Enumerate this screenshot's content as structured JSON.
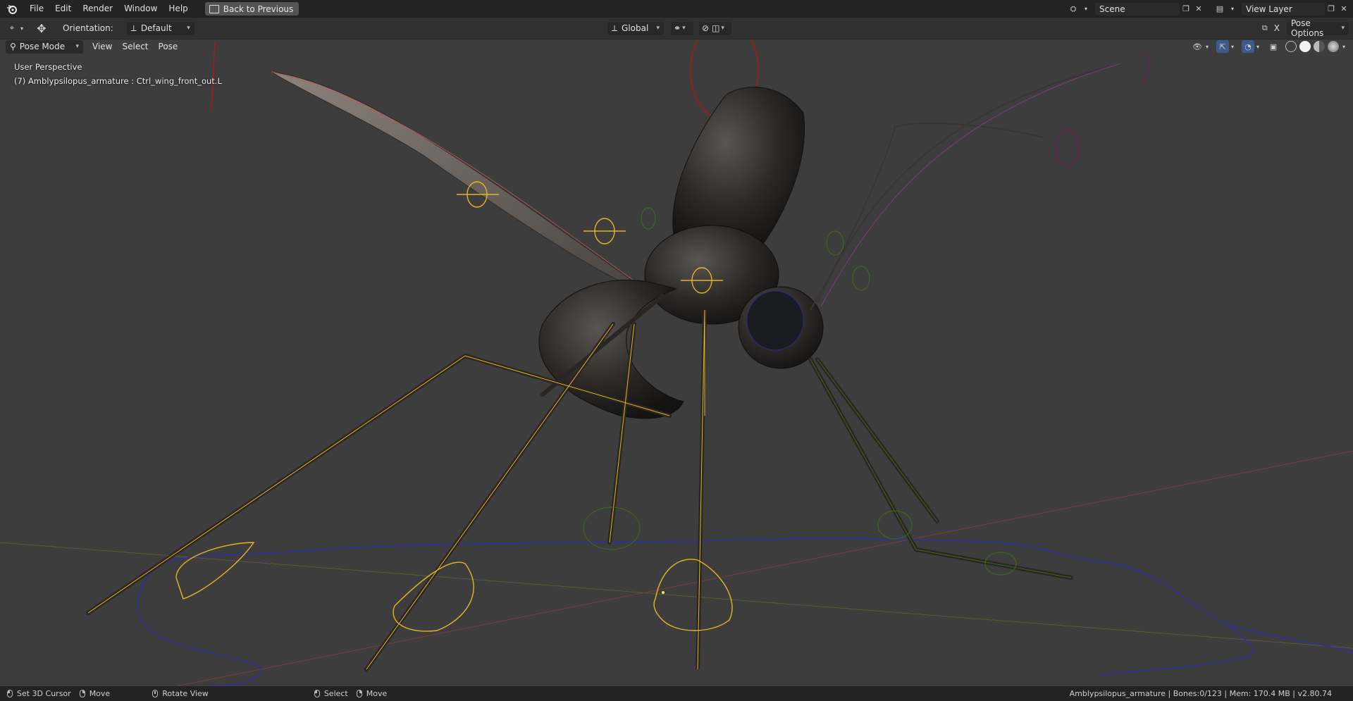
{
  "menu": {
    "items": [
      "File",
      "Edit",
      "Render",
      "Window",
      "Help"
    ],
    "back_button": "Back to Previous"
  },
  "top_right": {
    "scene_value": "Scene",
    "view_layer_value": "View Layer"
  },
  "header": {
    "orientation_label": "Orientation:",
    "orientation_value": "Default",
    "transform_value": "Global",
    "pose_options": "Pose Options",
    "x_label": "X"
  },
  "viewport_header": {
    "mode": "Pose Mode",
    "menus": [
      "View",
      "Select",
      "Pose"
    ]
  },
  "viewport": {
    "perspective": "User Perspective",
    "active_info": "(7) Amblypsilopus_armature : Ctrl_wing_front_out.L"
  },
  "statusbar": {
    "set_cursor": "Set 3D Cursor",
    "move1": "Move",
    "rotate_view": "Rotate View",
    "select": "Select",
    "move2": "Move",
    "info": "Amblypsilopus_armature | Bones:0/123 | Mem: 170.4 MB | v2.80.74"
  },
  "colors": {
    "topbar": "#232323",
    "header": "#303030",
    "viewport": "#3d3d3d",
    "bone_selected": "#e6b520",
    "bone_control": "#2a2aa8",
    "bone_red": "#b01515",
    "bone_green": "#3f6b1a"
  },
  "icons": [
    "blender-logo-icon",
    "editor-type-icon",
    "transform-gizmo-icon",
    "orientation-icon",
    "transform-icon",
    "snap-icon",
    "proportional-icon",
    "scene-icon",
    "view-layer-icon",
    "overlay-icon",
    "gizmo-icon",
    "xray-icon",
    "shading-wire-icon",
    "shading-solid-icon",
    "shading-material-icon",
    "shading-render-icon",
    "mouse-left-icon",
    "mouse-middle-icon",
    "mouse-right-icon"
  ]
}
